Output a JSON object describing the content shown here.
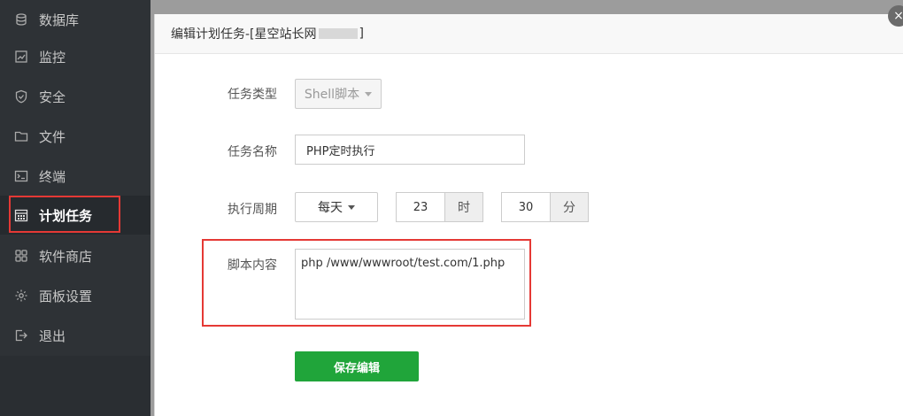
{
  "sidebar": {
    "items": [
      {
        "label": "数据库",
        "icon": "database-icon"
      },
      {
        "label": "监控",
        "icon": "monitor-chart-icon"
      },
      {
        "label": "安全",
        "icon": "shield-icon"
      },
      {
        "label": "文件",
        "icon": "folder-icon"
      },
      {
        "label": "终端",
        "icon": "terminal-icon"
      },
      {
        "label": "计划任务",
        "icon": "calendar-icon",
        "active": true
      },
      {
        "label": "软件商店",
        "icon": "apps-grid-icon"
      },
      {
        "label": "面板设置",
        "icon": "gear-icon"
      },
      {
        "label": "退出",
        "icon": "logout-icon"
      }
    ]
  },
  "modal": {
    "title_prefix": "编辑计划任务-[星空站长网",
    "title_suffix": "]",
    "close_symbol": "×",
    "task_type": {
      "label": "任务类型",
      "value": "Shell脚本"
    },
    "task_name": {
      "label": "任务名称",
      "value": "PHP定时执行"
    },
    "cycle": {
      "label": "执行周期",
      "period": "每天",
      "hour": "23",
      "hour_unit": "时",
      "minute": "30",
      "minute_unit": "分"
    },
    "script": {
      "label": "脚本内容",
      "value": "php /www/wwwroot/test.com/1.php"
    },
    "save_label": "保存编辑"
  },
  "colors": {
    "sidebar_bg": "#2e3236",
    "highlight": "#e53935",
    "save_button": "#20a53a"
  }
}
